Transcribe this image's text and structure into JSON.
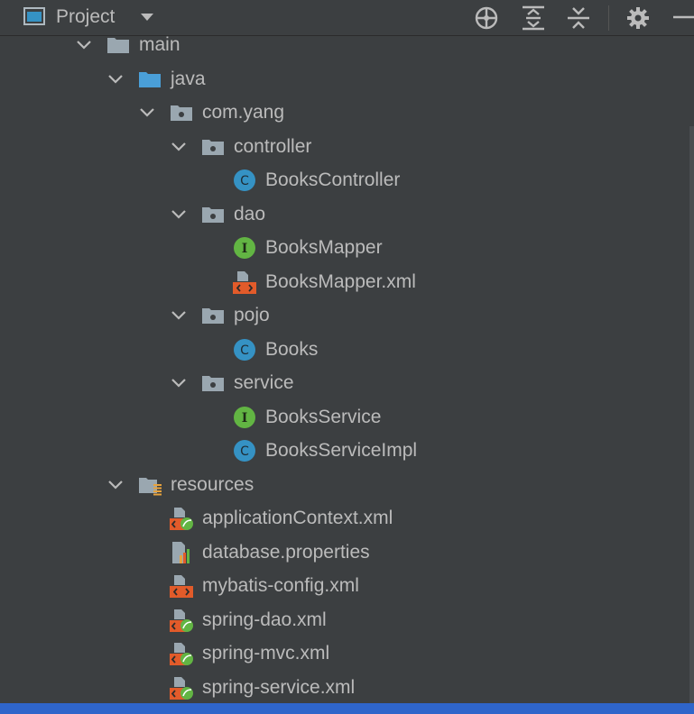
{
  "header": {
    "title": "Project",
    "icons": {
      "project": "project-window-icon",
      "dropdown": "chevron-down-icon",
      "locate": "crosshair-icon",
      "expand": "expand-all-icon",
      "collapse": "collapse-all-icon",
      "settings": "gear-icon",
      "hide": "minimize-icon"
    }
  },
  "tree": [
    {
      "label": "main",
      "icon": "folder-icon",
      "expanded": true
    },
    {
      "label": "java",
      "icon": "source-folder-icon",
      "expanded": true
    },
    {
      "label": "com.yang",
      "icon": "package-icon",
      "expanded": true
    },
    {
      "label": "controller",
      "icon": "package-icon",
      "expanded": true
    },
    {
      "label": "BooksController",
      "icon": "class-icon"
    },
    {
      "label": "dao",
      "icon": "package-icon",
      "expanded": true
    },
    {
      "label": "BooksMapper",
      "icon": "interface-icon"
    },
    {
      "label": "BooksMapper.xml",
      "icon": "xml-file-icon"
    },
    {
      "label": "pojo",
      "icon": "package-icon",
      "expanded": true
    },
    {
      "label": "Books",
      "icon": "class-icon"
    },
    {
      "label": "service",
      "icon": "package-icon",
      "expanded": true
    },
    {
      "label": "BooksService",
      "icon": "interface-icon"
    },
    {
      "label": "BooksServiceImpl",
      "icon": "class-icon"
    },
    {
      "label": "resources",
      "icon": "resources-folder-icon",
      "expanded": true
    },
    {
      "label": "applicationContext.xml",
      "icon": "spring-xml-icon"
    },
    {
      "label": "database.properties",
      "icon": "properties-file-icon"
    },
    {
      "label": "mybatis-config.xml",
      "icon": "xml-file-icon"
    },
    {
      "label": "spring-dao.xml",
      "icon": "spring-xml-icon"
    },
    {
      "label": "spring-mvc.xml",
      "icon": "spring-xml-icon"
    },
    {
      "label": "spring-service.xml",
      "icon": "spring-xml-icon"
    }
  ],
  "colors": {
    "background": "#3c3f41",
    "text": "#bbbbbb",
    "class": "#3592c4",
    "interface": "#62b543",
    "xml": "#e25b2a",
    "spring": "#62b543",
    "folder": "#9aa7b0",
    "source_folder": "#4a9fd8",
    "selection": "#2f65ca"
  }
}
